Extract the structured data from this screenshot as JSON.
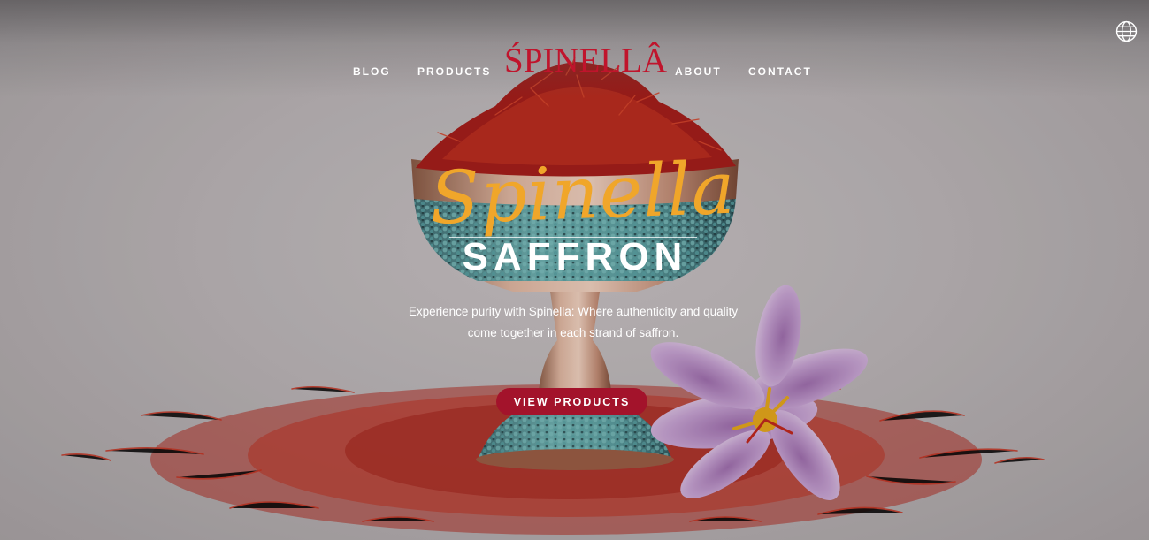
{
  "nav": {
    "links": [
      {
        "label": "BLOG"
      },
      {
        "label": "PRODUCTS"
      },
      {
        "label": "ABOUT"
      },
      {
        "label": "CONTACT"
      }
    ],
    "logo_text": "ŚPINELLÂ",
    "language_icon": "globe-icon"
  },
  "hero": {
    "script_title": "Spinella",
    "main_title": "SAFFRON",
    "tagline_line1": "Experience purity with Spinella: Where authenticity and quality",
    "tagline_line2": "come together in each strand of saffron.",
    "cta_label": "VIEW PRODUCTS"
  },
  "colors": {
    "brand_red": "#c0142c",
    "button_red": "#a3132b",
    "script_gold": "#f0a62a",
    "background": "#bdb8ba"
  }
}
